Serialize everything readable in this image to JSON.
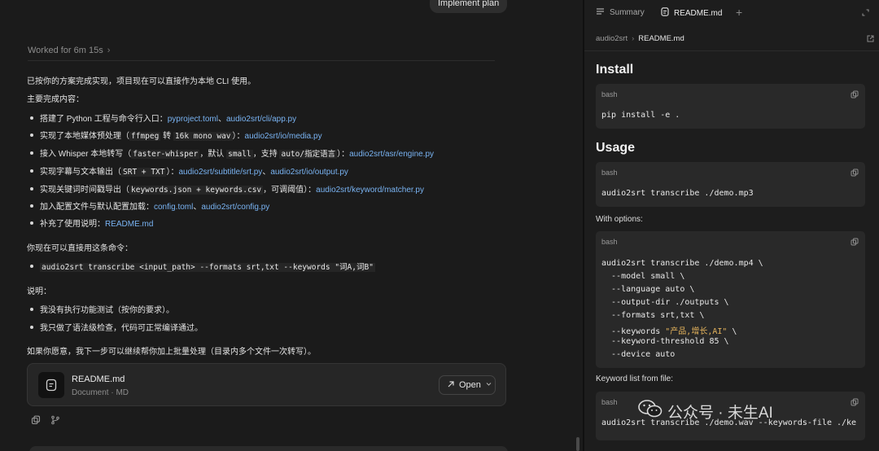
{
  "chat": {
    "implement_plan_label": "Implement plan",
    "worked_for": "Worked for 6m 15s",
    "intro": "已按你的方案完成实现，项目现在可以直接作为本地 CLI 使用。",
    "main_heading": "主要完成内容：",
    "items": [
      {
        "pre": "搭建了 Python 工程与命令行入口：",
        "code1": "",
        "mid": "",
        "code2": "",
        "mid2": "",
        "code3": "",
        "post": "",
        "link1": "pyproject.toml",
        "sep": "、",
        "link2": "audio2srt/cli/app.py"
      },
      {
        "pre": "实现了本地媒体预处理（",
        "code1": "ffmpeg",
        "mid": " 转 ",
        "code2": "16k mono wav",
        "mid2": "）：",
        "code3": "",
        "post": "",
        "link1": "audio2srt/io/media.py",
        "sep": "",
        "link2": ""
      },
      {
        "pre": "接入 Whisper 本地转写（",
        "code1": "faster-whisper",
        "mid": "，默认 ",
        "code2": "small",
        "mid2": "，支持 ",
        "code3": "auto/指定语言",
        "post": "）：",
        "link1": "audio2srt/asr/engine.py",
        "sep": "",
        "link2": ""
      },
      {
        "pre": "实现字幕与文本输出（",
        "code1": "SRT + TXT",
        "mid": "）：",
        "code2": "",
        "mid2": "",
        "code3": "",
        "post": "",
        "link1": "audio2srt/subtitle/srt.py",
        "sep": "、",
        "link2": "audio2srt/io/output.py"
      },
      {
        "pre": "实现关键词时间戳导出（",
        "code1": "keywords.json + keywords.csv",
        "mid": "，可调阈值）：",
        "code2": "",
        "mid2": "",
        "code3": "",
        "post": "",
        "link1": "audio2srt/keyword/matcher.py",
        "sep": "",
        "link2": ""
      },
      {
        "pre": "加入配置文件与默认配置加载：",
        "code1": "",
        "mid": "",
        "code2": "",
        "mid2": "",
        "code3": "",
        "post": "",
        "link1": "config.toml",
        "sep": "、",
        "link2": "audio2srt/config.py"
      },
      {
        "pre": "补充了使用说明：",
        "code1": "",
        "mid": "",
        "code2": "",
        "mid2": "",
        "code3": "",
        "post": "",
        "link1": "README.md",
        "sep": "",
        "link2": ""
      }
    ],
    "command_heading": "你现在可以直接用这条命令：",
    "command": "audio2srt transcribe <input_path> --formats srt,txt --keywords \"词A,词B\"",
    "notes_heading": "说明：",
    "notes": [
      "我没有执行功能测试（按你的要求）。",
      "我只做了语法级检查，代码可正常编译通过。"
    ],
    "closing": "如果你愿意，我下一步可以继续帮你加上批量处理（目录内多个文件一次转写）。",
    "file_card": {
      "name": "README.md",
      "meta": "Document · MD",
      "open_label": "Open"
    }
  },
  "panel": {
    "tabs": [
      {
        "label": "Summary",
        "icon": "list-icon"
      },
      {
        "label": "README.md",
        "icon": "document-icon"
      }
    ],
    "breadcrumb": [
      "audio2srt",
      "README.md"
    ],
    "install_heading": "Install",
    "usage_heading": "Usage",
    "with_options": "With options:",
    "keyword_list": "Keyword list from file:",
    "code_lang": "bash",
    "install_cmd": "pip install -e .",
    "usage_cmd": "audio2srt transcribe ./demo.mp3",
    "options_lines": [
      "audio2srt transcribe ./demo.mp4 \\",
      "  --model small \\",
      "  --language auto \\",
      "  --output-dir ./outputs \\",
      "  --formats srt,txt \\",
      "  --keywords ",
      "  --keyword-threshold 85 \\",
      "  --device auto"
    ],
    "keywords_string": "\"产品,增长,AI\"",
    "keywords_tail": " \\",
    "file_cmd": "audio2srt transcribe ./demo.wav --keywords-file ./ke"
  },
  "watermark": {
    "text": "公众号 · 未生AI"
  },
  "colors": {
    "link": "#79b3f2",
    "string": "#e3b25c",
    "background": "#1b1b1b"
  }
}
